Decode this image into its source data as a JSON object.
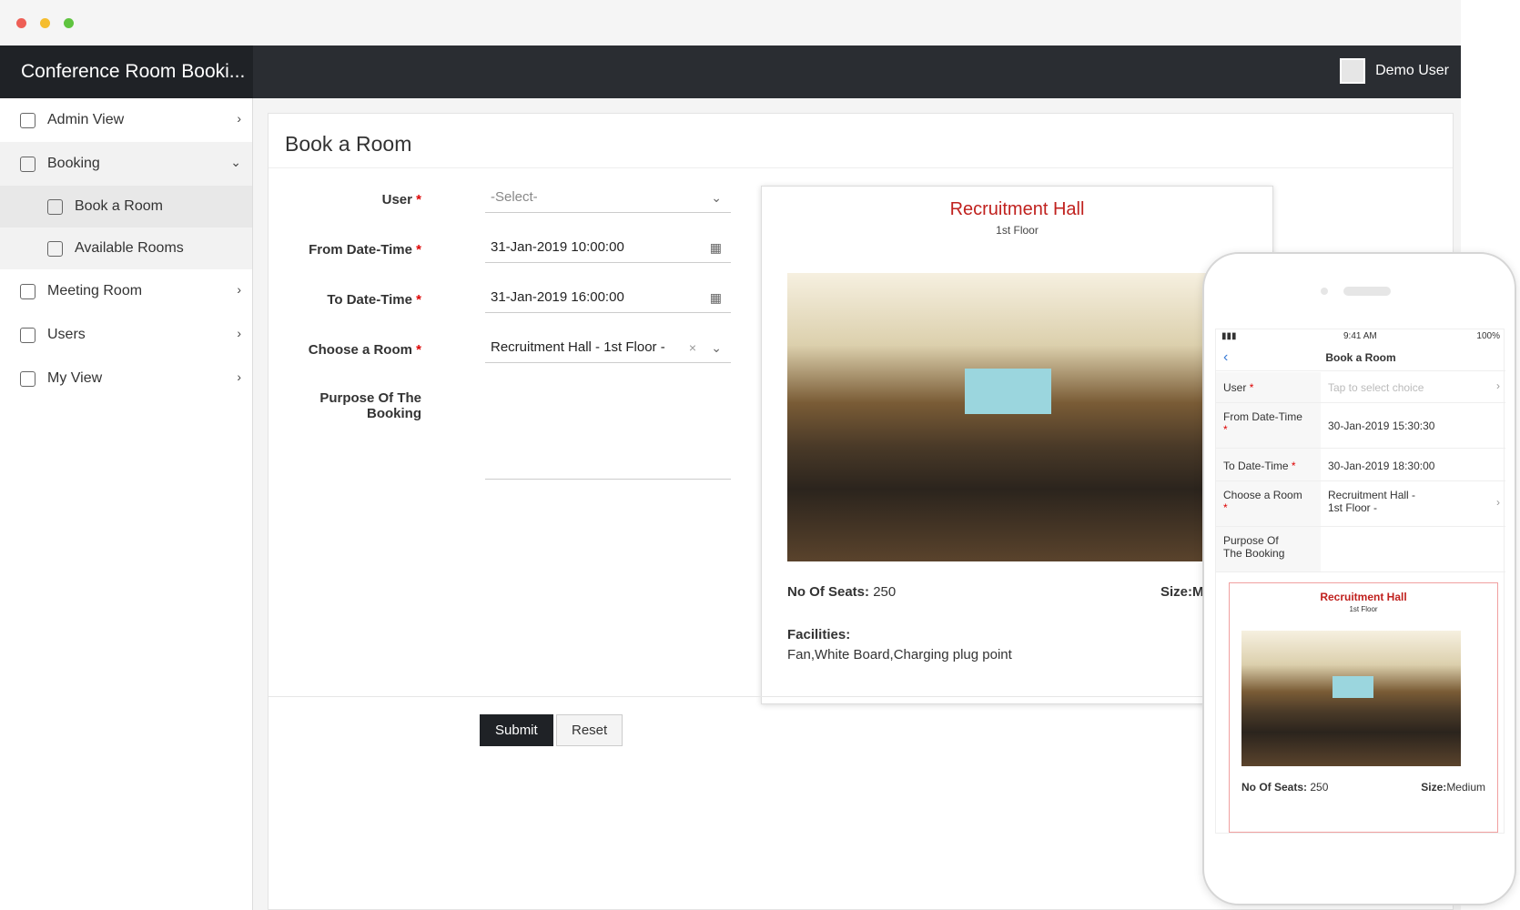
{
  "app": {
    "title": "Conference Room Booki...",
    "user_name": "Demo User"
  },
  "sidebar": {
    "items": [
      {
        "label": "Admin View"
      },
      {
        "label": "Booking"
      },
      {
        "label": "Book a Room"
      },
      {
        "label": "Available Rooms"
      },
      {
        "label": "Meeting Room"
      },
      {
        "label": "Users"
      },
      {
        "label": "My View"
      }
    ]
  },
  "form": {
    "title": "Book a Room",
    "user_label": "User",
    "user_value": "-Select-",
    "from_label": "From Date-Time",
    "from_value": "31-Jan-2019 10:00:00",
    "to_label": "To Date-Time",
    "to_value": "31-Jan-2019 16:00:00",
    "room_label": "Choose a Room",
    "room_value": "Recruitment Hall - 1st Floor -",
    "purpose_label": "Purpose Of The Booking",
    "required_mark": "*",
    "submit_label": "Submit",
    "reset_label": "Reset"
  },
  "room_card": {
    "name": "Recruitment Hall",
    "floor": "1st Floor",
    "seats_label": "No Of Seats:",
    "seats_value": "250",
    "size_label": "Size:M",
    "facilities_label": "Facilities:",
    "facilities_value": "Fan,White Board,Charging plug point"
  },
  "mobile": {
    "time": "9:41 AM",
    "battery": "100%",
    "title": "Book a Room",
    "user_label": "User",
    "user_placeholder": "Tap to select choice",
    "from_label": "From Date-Time",
    "from_value": "30-Jan-2019 15:30:30",
    "to_label": "To Date-Time",
    "to_value": "30-Jan-2019 18:30:00",
    "room_label": "Choose a Room",
    "room_value_line1": "Recruitment Hall -",
    "room_value_line2": "1st Floor -",
    "purpose_line1": "Purpose Of",
    "purpose_line2": "The Booking",
    "room_name": "Recruitment Hall",
    "room_floor": "1st Floor",
    "seats_label": "No Of Seats:",
    "seats_value": "250",
    "size_label": "Size:",
    "size_value": "Medium"
  },
  "colors": {
    "accent_red": "#c0211e",
    "header_dark": "#2a2d32"
  }
}
